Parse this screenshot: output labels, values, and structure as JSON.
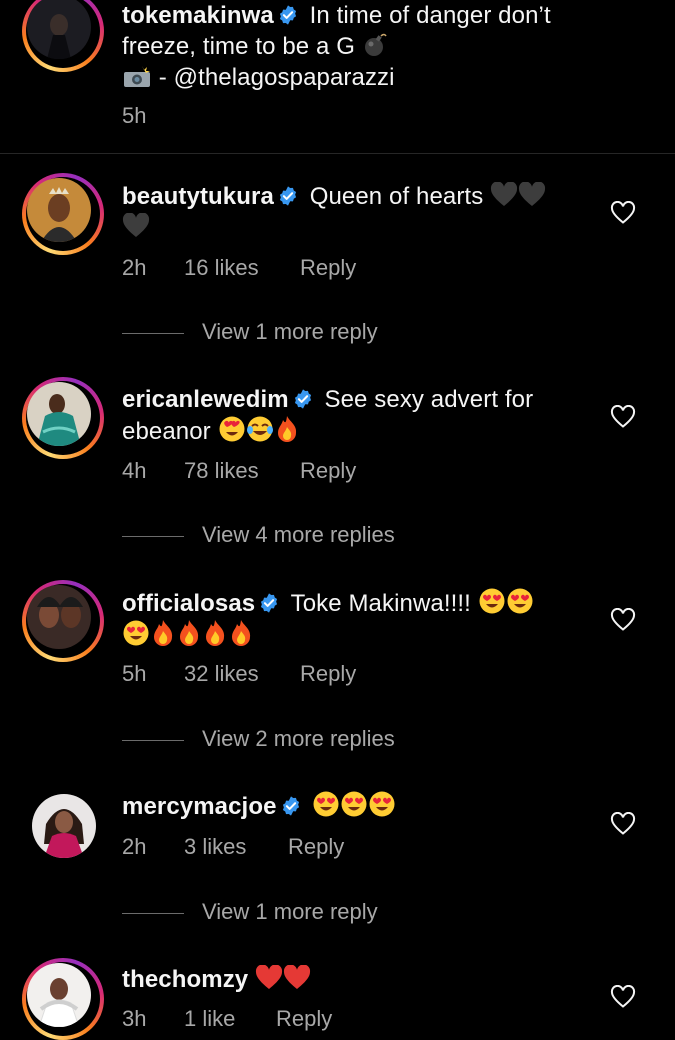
{
  "caption": {
    "username": "tokemakinwa",
    "verified": true,
    "text": "In time of danger don’t freeze, time to be a G",
    "credit": " - @thelagospaparazzi",
    "time": "5h"
  },
  "comments": [
    {
      "username": "beautytukura",
      "verified": true,
      "text": "Queen of hearts",
      "time": "2h",
      "likes": "16 likes",
      "reply": "Reply",
      "view_replies": "View 1 more reply"
    },
    {
      "username": "ericanlewedim",
      "verified": true,
      "text": "See sexy advert for ebeanor",
      "time": "4h",
      "likes": "78 likes",
      "reply": "Reply",
      "view_replies": "View 4 more replies"
    },
    {
      "username": "officialosas",
      "verified": true,
      "text": "Toke Makinwa!!!!",
      "time": "5h",
      "likes": "32 likes",
      "reply": "Reply",
      "view_replies": "View 2 more replies"
    },
    {
      "username": "mercymacjoe",
      "verified": true,
      "text": "",
      "time": "2h",
      "likes": "3 likes",
      "reply": "Reply",
      "view_replies": "View 1 more reply"
    },
    {
      "username": "thechomzy",
      "verified": false,
      "text": "",
      "time": "3h",
      "likes": "1 like",
      "reply": "Reply"
    }
  ],
  "colors": {
    "background": "#000000",
    "text": "#f5f5f5",
    "secondary_text": "#a8a8a8",
    "verified_blue": "#3897f0",
    "divider": "#262626"
  },
  "icons": {
    "verified": "verified-badge-icon",
    "like": "heart-outline-icon",
    "bomb": "bomb-icon",
    "camera": "camera-flash-icon"
  }
}
